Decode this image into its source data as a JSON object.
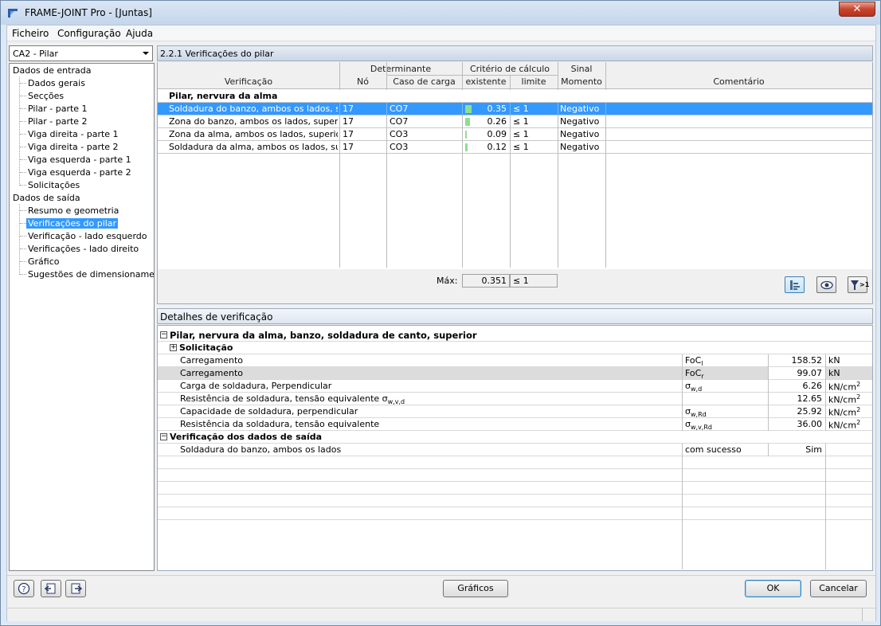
{
  "window": {
    "title": "FRAME-JOINT Pro - [Juntas]",
    "close_label": "✕"
  },
  "menu": [
    "Ficheiro",
    "Configuração",
    "Ajuda"
  ],
  "case_combo": {
    "value": "CA2 - Pilar"
  },
  "tree": {
    "input_group": "Dados de entrada",
    "input_items": [
      "Dados gerais",
      "Secções",
      "Pilar - parte 1",
      "Pilar - parte 2",
      "Viga direita - parte 1",
      "Viga direita - parte 2",
      "Viga esquerda - parte 1",
      "Viga esquerda - parte 2",
      "Solicitações"
    ],
    "output_group": "Dados de saída",
    "output_items": [
      "Resumo e geometria",
      "Verificações do pilar",
      "Verificação - lado esquerdo",
      "Verificações - lado direito",
      "Gráfico",
      "Sugestões de dimensionamento"
    ],
    "selected": "Verificações do pilar"
  },
  "table": {
    "title": "2.2.1 Verificações do pilar",
    "headers": {
      "verificacao": "Verificação",
      "determinante": "Determinante",
      "no": "Nó",
      "caso": "Caso de carga",
      "criterio": "Critério de cálculo",
      "existente": "existente",
      "limite": "limite",
      "sinal": "Sinal",
      "momento": "Momento",
      "comentario": "Comentário"
    },
    "group": "Pilar, nervura da alma",
    "rows": [
      {
        "verificacao": "Soldadura do banzo, ambos os lados, superior",
        "no": "17",
        "caso": "CO7",
        "existente": "0.35",
        "ratio": 0.35,
        "limite": "≤ 1",
        "sinal": "Negativo",
        "selected": true
      },
      {
        "verificacao": "Zona do banzo, ambos os lados, superior",
        "no": "17",
        "caso": "CO7",
        "existente": "0.26",
        "ratio": 0.26,
        "limite": "≤ 1",
        "sinal": "Negativo",
        "selected": false
      },
      {
        "verificacao": "Zona da alma, ambos os lados, superior",
        "no": "17",
        "caso": "CO3",
        "existente": "0.09",
        "ratio": 0.09,
        "limite": "≤ 1",
        "sinal": "Negativo",
        "selected": false
      },
      {
        "verificacao": "Soldadura da alma, ambos os lados, superior",
        "no": "17",
        "caso": "CO3",
        "existente": "0.12",
        "ratio": 0.12,
        "limite": "≤ 1",
        "sinal": "Negativo",
        "selected": false
      }
    ],
    "max_label": "Máx:",
    "max_value": "0.351",
    "max_limit": "≤ 1",
    "toolbar_icons": [
      "table-chart-icon",
      "eye-icon",
      "filter-greater-one-icon"
    ],
    "filter_label": ">1"
  },
  "details": {
    "title": "Detalhes de verificação",
    "section1": "Pilar, nervura da alma, banzo, soldadura de canto, superior",
    "subsection": "Solicitação",
    "rows": [
      {
        "label": "Carregamento",
        "symbol": "FoC",
        "sub": "l",
        "value": "158.52",
        "unit": "kN",
        "shaded": false
      },
      {
        "label": "Carregamento",
        "symbol": "FoC",
        "sub": "r",
        "value": "99.07",
        "unit": "kN",
        "shaded": true
      },
      {
        "label": "Carga de soldadura, Perpendicular",
        "symbol": "σ",
        "sub": "w,d",
        "value": "6.26",
        "unit": "kN/cm",
        "sup": "2",
        "shaded": false
      },
      {
        "label": "Resistência de soldadura, tensão equivalente σ",
        "label_sub": "w,v,d",
        "symbol": "",
        "sub": "",
        "value": "12.65",
        "unit": "kN/cm",
        "sup": "2",
        "shaded": false
      },
      {
        "label": "Capacidade de soldadura, perpendicular",
        "symbol": "σ",
        "sub": "w,Rd",
        "value": "25.92",
        "unit": "kN/cm",
        "sup": "2",
        "shaded": false
      },
      {
        "label": "Resistência da soldadura, tensão equivalente",
        "symbol": "σ",
        "sub": "w,v,Rd",
        "value": "36.00",
        "unit": "kN/cm",
        "sup": "2",
        "shaded": false
      }
    ],
    "section2": "Verificação dos dados de saída",
    "result_row": {
      "label": "Soldadura do banzo, ambos os lados",
      "symbol": "com sucesso",
      "value": "Sim"
    }
  },
  "buttons": {
    "graficos": "Gráficos",
    "ok": "OK",
    "cancelar": "Cancelar"
  },
  "bottom_icons": [
    "help-icon",
    "export-icon",
    "import-icon"
  ]
}
